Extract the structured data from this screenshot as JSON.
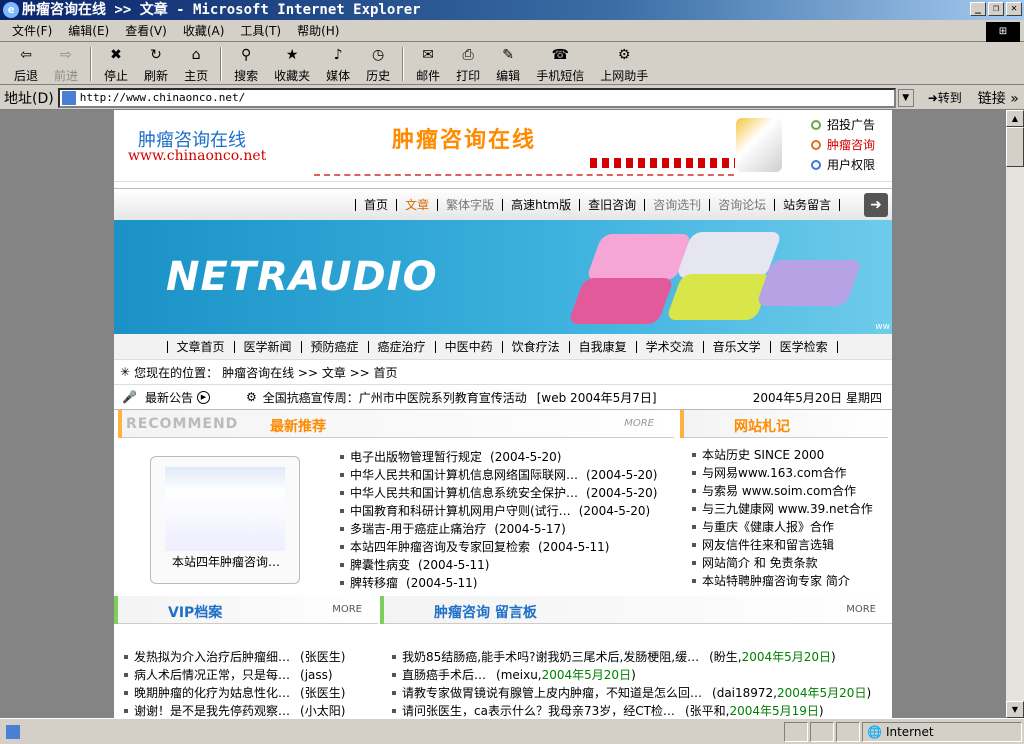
{
  "window": {
    "title": "肿瘤咨询在线 >> 文章 - Microsoft Internet Explorer",
    "buttons": [
      "_",
      "❐",
      "✕"
    ]
  },
  "menu": [
    "文件(F)",
    "编辑(E)",
    "查看(V)",
    "收藏(A)",
    "工具(T)",
    "帮助(H)"
  ],
  "toolbar": [
    {
      "label": "后退",
      "icon": "back-arrow-icon",
      "glyph": "⇦"
    },
    {
      "label": "前进",
      "icon": "forward-arrow-icon",
      "glyph": "⇨"
    },
    {
      "label": "停止",
      "icon": "stop-icon",
      "glyph": "✖"
    },
    {
      "label": "刷新",
      "icon": "refresh-icon",
      "glyph": "↻"
    },
    {
      "label": "主页",
      "icon": "home-icon",
      "glyph": "⌂"
    },
    {
      "label": "搜索",
      "icon": "search-icon",
      "glyph": "⚲"
    },
    {
      "label": "收藏夹",
      "icon": "favorites-icon",
      "glyph": "★"
    },
    {
      "label": "媒体",
      "icon": "media-icon",
      "glyph": "♪"
    },
    {
      "label": "历史",
      "icon": "history-icon",
      "glyph": "◷"
    },
    {
      "label": "邮件",
      "icon": "mail-icon",
      "glyph": "✉"
    },
    {
      "label": "打印",
      "icon": "print-icon",
      "glyph": "⎙"
    },
    {
      "label": "编辑",
      "icon": "edit-icon",
      "glyph": "✎"
    },
    {
      "label": "手机短信",
      "icon": "phone-sms-icon",
      "glyph": "☎"
    },
    {
      "label": "上网助手",
      "icon": "assistant-icon",
      "glyph": "⚙"
    }
  ],
  "address": {
    "label": "地址(D)",
    "url": "http://www.chinaonco.net/",
    "goto": "转到",
    "links": "链接"
  },
  "status": {
    "text": "",
    "zone": "Internet"
  },
  "site": {
    "logo_name": "肿瘤咨询在线",
    "logo_url": "www.chinaonco.net",
    "big_title": "肿瘤咨询在线",
    "header_links": [
      "招投广告",
      "肿瘤咨询",
      "用户权限"
    ],
    "nav1": [
      "首页",
      "文章",
      "繁体字版",
      "高速htm版",
      "查旧咨询",
      "咨询选刊",
      "咨询论坛",
      "站务留言"
    ],
    "banner_text": "NETRAUDIO",
    "banner_small": "ww",
    "nav2": [
      "文章首页",
      "医学新闻",
      "预防癌症",
      "癌症治疗",
      "中医中药",
      "饮食疗法",
      "自我康复",
      "学术交流",
      "音乐文学",
      "医学检索"
    ],
    "loc_label": "您现在的位置：",
    "loc_path": "肿瘤咨询在线 >> 文章 >> 首页",
    "ann_label": "最新公告",
    "ann_text": "全国抗癌宣传周：广州市中医院系列教育宣传活动",
    "ann_src": "[web  2004年5月7日]",
    "ann_date": "2004年5月20日  星期四",
    "recommend_ghost": "RECOMMEND",
    "recommend_title": "最新推荐",
    "more": "MORE",
    "thumb_caption": "本站四年肿瘤咨询…",
    "recommend": [
      {
        "t": "电子出版物管理暂行规定",
        "d": "(2004-5-20)"
      },
      {
        "t": "中华人民共和国计算机信息网络国际联网…",
        "d": "(2004-5-20)"
      },
      {
        "t": "中华人民共和国计算机信息系统安全保护…",
        "d": "(2004-5-20)"
      },
      {
        "t": "中国教育和科研计算机网用户守则(试行…",
        "d": "(2004-5-20)"
      },
      {
        "t": "多瑞吉-用于癌症止痛治疗",
        "d": "(2004-5-17)"
      },
      {
        "t": "本站四年肿瘤咨询及专家回复检索",
        "d": "(2004-5-11)"
      },
      {
        "t": "脾囊性病变",
        "d": "(2004-5-11)"
      },
      {
        "t": "脾转移瘤",
        "d": "(2004-5-11)"
      }
    ],
    "notes_title": "网站札记",
    "notes": [
      "本站历史  SINCE 2000",
      "与网易www.163.com合作",
      "与索易 www.soim.com合作",
      "与三九健康网 www.39.net合作",
      "与重庆《健康人报》合作",
      "网友信件往来和留言选辑",
      "网站简介 和 免责条款",
      "本站特聘肿瘤咨询专家 简介"
    ],
    "vip_title": "VIP档案",
    "board_title": "肿瘤咨询  留言板",
    "vip": [
      {
        "t": "发热拟为介入治疗后肿瘤细…",
        "u": "(张医生)"
      },
      {
        "t": "病人术后情况正常，只是每…",
        "u": "(jass)"
      },
      {
        "t": "晚期肿瘤的化疗为姑息性化…",
        "u": "(张医生)"
      },
      {
        "t": "谢谢！是不是我先停药观察…",
        "u": "(小太阳)"
      }
    ],
    "board": [
      {
        "t": "我奶85结肠癌,能手术吗?谢我奶三尾术后,发肠梗阻,缓…",
        "u": "(盼生,",
        "d": "2004年5月20日",
        ")": ")"
      },
      {
        "t": "直肠癌手术后…",
        "u": "(meixu,",
        "d": "2004年5月20日",
        ")": ")"
      },
      {
        "t": "请教专家做胃镜说有腺管上皮内肿瘤，不知道是怎么回…",
        "u": "(dai18972,",
        "d": "2004年5月20日",
        ")": ")"
      },
      {
        "t": "请问张医生，ca表示什么？我母亲73岁，经CT检…",
        "u": "(张平和,",
        "d": "2004年5月19日",
        ")": ")"
      }
    ]
  }
}
